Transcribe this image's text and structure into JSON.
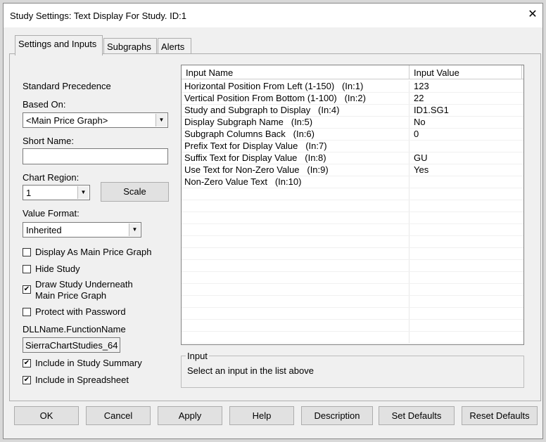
{
  "window": {
    "title": "Study Settings: Text Display For Study. ID:1",
    "close": "✕"
  },
  "tabs": [
    {
      "label": "Settings and Inputs"
    },
    {
      "label": "Subgraphs"
    },
    {
      "label": "Alerts"
    }
  ],
  "left": {
    "precedence": "Standard Precedence",
    "based_on_label": "Based On:",
    "based_on_value": "<Main Price Graph>",
    "short_name_label": "Short Name:",
    "short_name_value": "",
    "chart_region_label": "Chart Region:",
    "chart_region_value": "1",
    "scale_label": "Scale",
    "value_format_label": "Value Format:",
    "value_format_value": "Inherited",
    "checkboxes": [
      {
        "label": "Display As Main Price Graph",
        "checked": false
      },
      {
        "label": "Hide Study",
        "checked": false
      },
      {
        "label": "Draw Study Underneath",
        "label2": "Main Price Graph",
        "checked": true
      },
      {
        "label": "Protect with Password",
        "checked": false
      }
    ],
    "dll_label": "DLLName.FunctionName",
    "dll_value": "SierraChartStudies_64",
    "checkboxes2": [
      {
        "label": "Include in Study Summary",
        "checked": true
      },
      {
        "label": "Include in Spreadsheet",
        "checked": true
      }
    ]
  },
  "grid": {
    "headers": [
      "Input Name",
      "Input Value"
    ],
    "rows": [
      {
        "name": "Horizontal Position From Left (1-150)   (In:1)",
        "value": "123"
      },
      {
        "name": "Vertical Position From Bottom (1-100)   (In:2)",
        "value": "22"
      },
      {
        "name": "Study and Subgraph to Display   (In:4)",
        "value": "ID1.SG1"
      },
      {
        "name": "Display Subgraph Name   (In:5)",
        "value": "No"
      },
      {
        "name": "Subgraph Columns Back   (In:6)",
        "value": "0"
      },
      {
        "name": "Prefix Text for Display Value   (In:7)",
        "value": ""
      },
      {
        "name": "Suffix Text for Display Value   (In:8)",
        "value": "GU"
      },
      {
        "name": "Use Text for Non-Zero Value   (In:9)",
        "value": "Yes"
      },
      {
        "name": "Non-Zero Value Text   (In:10)",
        "value": ""
      }
    ]
  },
  "input_group": {
    "title": "Input",
    "text": "Select an input in the list above"
  },
  "buttons": [
    "OK",
    "Cancel",
    "Apply",
    "Help",
    "Description",
    "Set Defaults",
    "Reset Defaults"
  ]
}
